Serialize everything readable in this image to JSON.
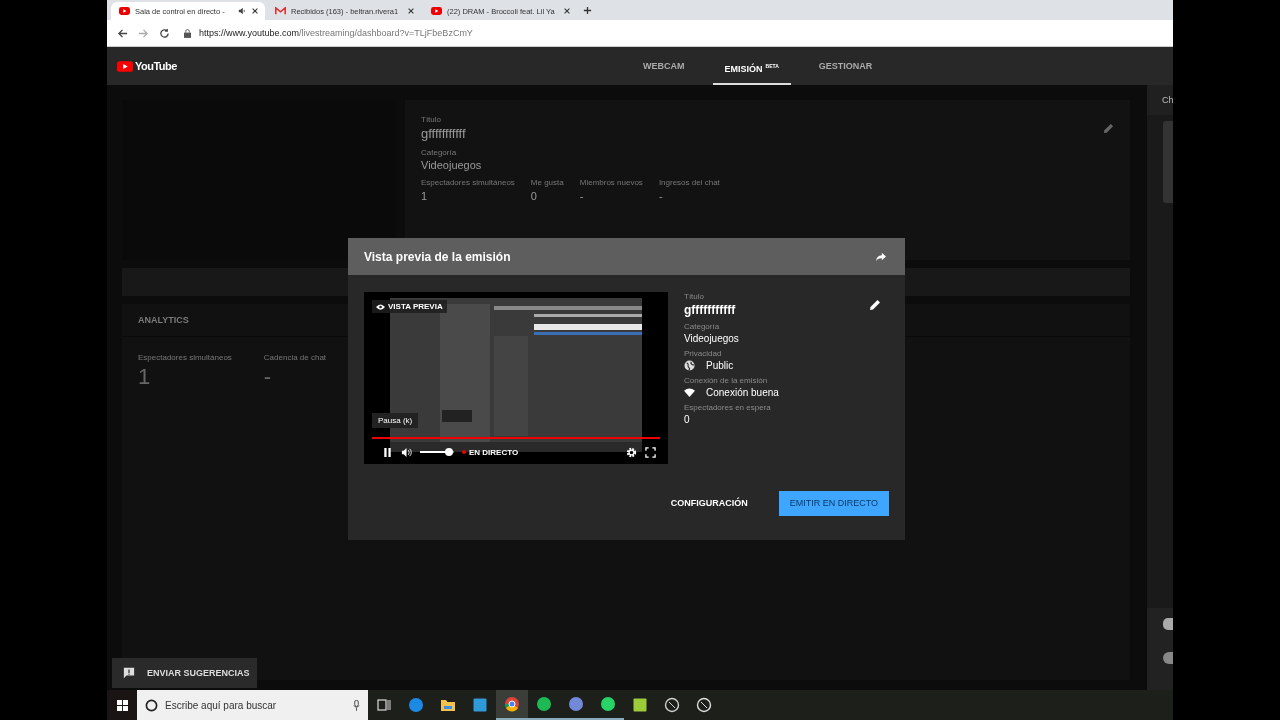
{
  "browser": {
    "tabs": [
      {
        "title": "Sala de control en directo -",
        "kind": "youtube",
        "audio": true,
        "selected": true
      },
      {
        "title": "Recibidos (163) - beltran.rivera1",
        "kind": "gmail",
        "audio": false,
        "selected": false
      },
      {
        "title": "(22) DRAM - Broccoli feat. Lil Ya",
        "kind": "youtube",
        "audio": false,
        "selected": false
      }
    ],
    "url_host": "https://www.youtube.com",
    "url_path": "/livestreaming/dashboard?v=TLjFbeBzCmY"
  },
  "header": {
    "logo": "YouTube",
    "nav": [
      {
        "label": "WEBCAM",
        "selected": false
      },
      {
        "label": "EMISIÓN",
        "badge": "BETA",
        "selected": true
      },
      {
        "label": "GESTIONAR",
        "selected": false
      }
    ]
  },
  "stream_info": {
    "fields": [
      {
        "label": "Título",
        "value": "gfffffffffff"
      },
      {
        "label": "Categoría",
        "value": "Videojuegos"
      }
    ],
    "stats": [
      {
        "label": "Espectadores simultáneos",
        "value": "1"
      },
      {
        "label": "Me gusta",
        "value": "0"
      },
      {
        "label": "Miembros nuevos",
        "value": "-"
      },
      {
        "label": "Ingresos del chat",
        "value": "-"
      }
    ]
  },
  "analytics": {
    "title": "ANALYTICS",
    "stats": [
      {
        "label": "Espectadores simultáneos",
        "value": "1"
      },
      {
        "label": "Cadencia de chat",
        "value": "-"
      }
    ]
  },
  "chat": {
    "title": "Ch"
  },
  "feedback_button": "ENVIAR SUGERENCIAS",
  "modal": {
    "title": "Vista previa de la emisión",
    "player": {
      "badge": "VISTA PREVIA",
      "tooltip": "Pausa (k)",
      "live": "EN DIRECTO",
      "playing": true,
      "volume": {
        "level": 0.85
      }
    },
    "details": [
      {
        "kind": "text",
        "label": "Título",
        "value": "gfffffffffff"
      },
      {
        "kind": "text",
        "label": "Categoría",
        "value": "Videojuegos"
      },
      {
        "kind": "privacy",
        "label": "Privacidad",
        "value": "Public"
      },
      {
        "kind": "connection",
        "label": "Conexión de la emisión",
        "value": "Conexión buena"
      },
      {
        "kind": "text",
        "label": "Espectadores en espera",
        "value": "0"
      }
    ],
    "buttons": [
      {
        "label": "CONFIGURACIÓN",
        "kind": "text"
      },
      {
        "label": "EMITIR EN DIRECTO",
        "kind": "primary"
      }
    ]
  },
  "taskbar": {
    "search_placeholder": "Escribe aquí para buscar",
    "apps": [
      {
        "kind": "taskview",
        "open": false,
        "selected": false
      },
      {
        "kind": "edge",
        "open": false,
        "selected": false
      },
      {
        "kind": "folder",
        "open": false,
        "selected": false
      },
      {
        "kind": "tile",
        "open": false,
        "selected": false
      },
      {
        "kind": "chrome",
        "open": true,
        "selected": true
      },
      {
        "kind": "spotify",
        "open": true,
        "selected": false
      },
      {
        "kind": "discord",
        "open": true,
        "selected": false
      },
      {
        "kind": "whatsapp",
        "open": true,
        "selected": false
      },
      {
        "kind": "stack",
        "open": false,
        "selected": false
      },
      {
        "kind": "obs",
        "open": false,
        "selected": false
      },
      {
        "kind": "satellite",
        "open": false,
        "selected": false
      }
    ]
  }
}
